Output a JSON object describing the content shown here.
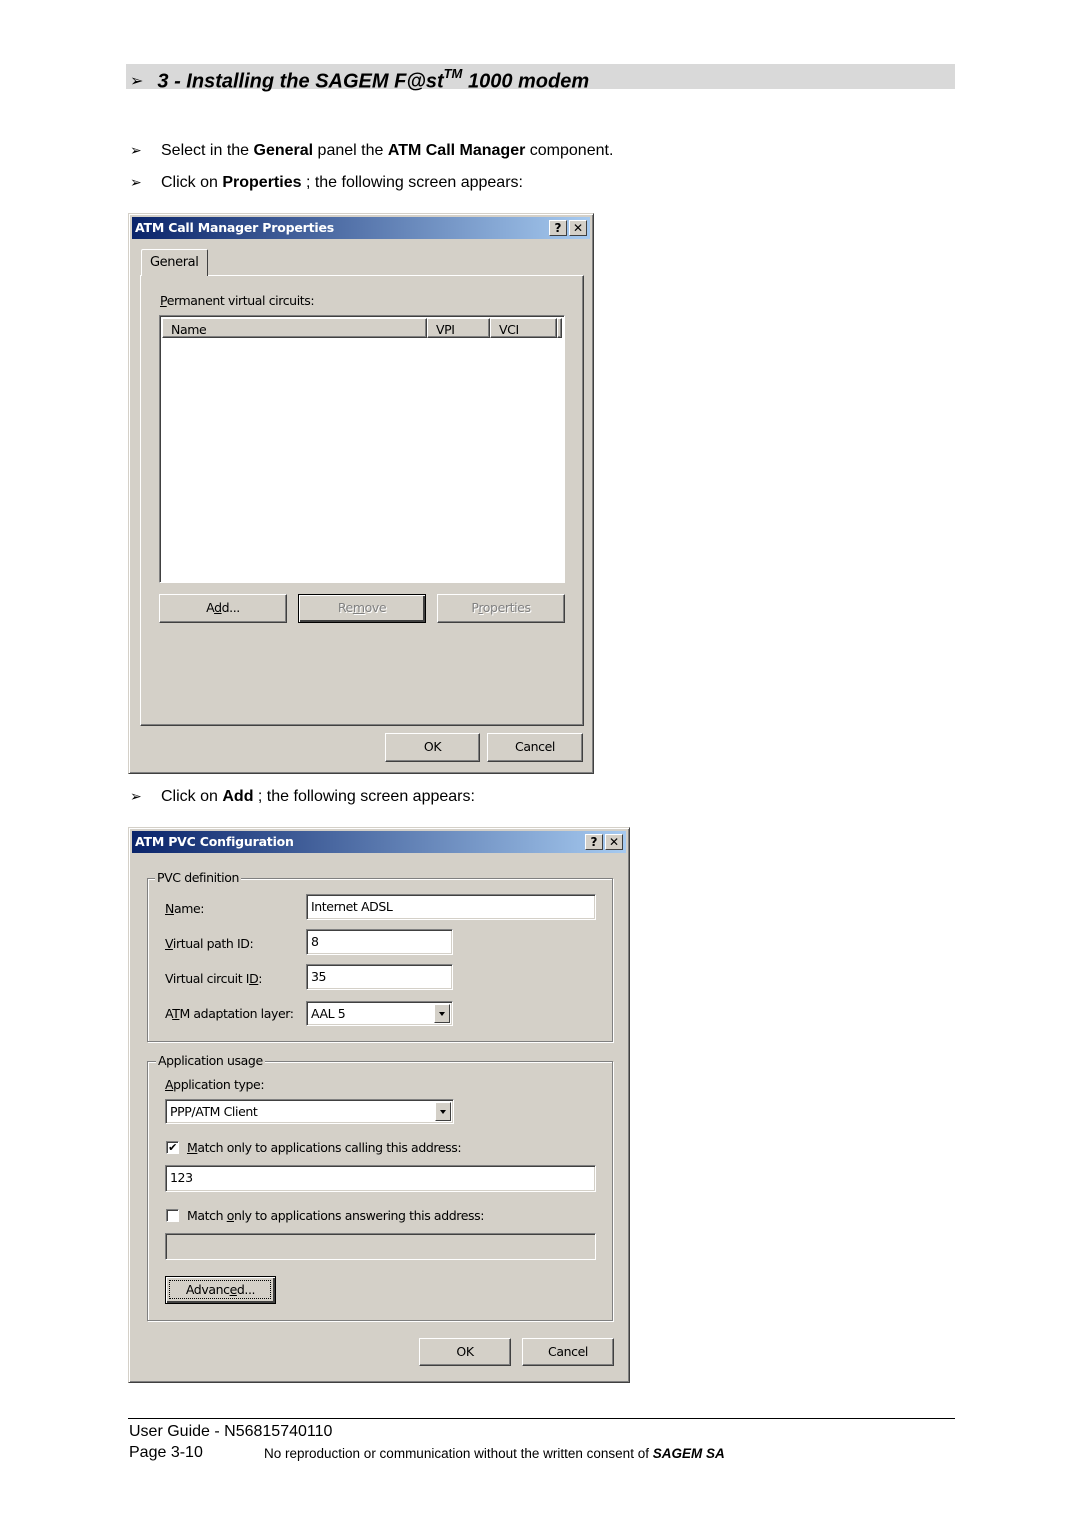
{
  "document": {
    "heading": {
      "bullet": "➢",
      "text_pre": "3 - Installing the SAGEM F@st",
      "superscript": "TM",
      "text_post": " 1000 modem"
    },
    "steps": [
      {
        "bullet": "➢",
        "parts": [
          "Select in the ",
          "General",
          " panel the ",
          "ATM Call Manager",
          " component."
        ]
      },
      {
        "bullet": "➢",
        "parts": [
          "Click on ",
          "Properties",
          " ; the following screen appears:"
        ]
      },
      {
        "bullet": "➢",
        "parts": [
          "Click on ",
          "Add",
          " ; the following screen appears:"
        ]
      }
    ],
    "footer": {
      "guide": "User Guide - N56815740110",
      "page": "Page 3-10",
      "notice": "No reproduction or communication without the written consent of ",
      "company": "SAGEM SA"
    }
  },
  "dialog_call_manager": {
    "title": "ATM Call Manager Properties",
    "help_button": "?",
    "close_button": "✕",
    "tab": "General",
    "pvc_label": {
      "accel": "P",
      "rest": "ermanent virtual circuits:"
    },
    "columns": [
      "Name",
      "VPI",
      "VCI"
    ],
    "rows": [],
    "buttons": {
      "add": {
        "pre": "A",
        "accel": "d",
        "post": "d..."
      },
      "remove": {
        "pre": "Re",
        "accel": "m",
        "post": "ove"
      },
      "properties": {
        "pre": "P",
        "accel": "r",
        "post": "operties"
      },
      "ok": "OK",
      "cancel": "Cancel"
    }
  },
  "dialog_pvc_config": {
    "title": "ATM PVC Configuration",
    "help_button": "?",
    "close_button": "✕",
    "pvc_definition": {
      "legend": "PVC definition",
      "name": {
        "label_accel": "N",
        "label_rest": "ame:",
        "value": "Internet ADSL"
      },
      "vpi": {
        "label_accel": "V",
        "label_rest": "irtual path ID:",
        "value": "8"
      },
      "vci": {
        "label_pre": "Virtual circuit I",
        "label_accel": "D",
        "label_post": ":",
        "value": "35"
      },
      "aal": {
        "label_pre": "A",
        "label_accel": "T",
        "label_post": "M adaptation layer:",
        "value": "AAL 5"
      }
    },
    "application_usage": {
      "legend": "Application usage",
      "type_label": {
        "accel": "A",
        "rest": "pplication type:"
      },
      "type_value": "PPP/ATM Client",
      "match_calling": {
        "checked": true,
        "check_glyph": "✔",
        "accel": "M",
        "rest": "atch only to applications calling this address:",
        "value": "123"
      },
      "match_answering": {
        "checked": false,
        "pre": "Match ",
        "accel": "o",
        "rest": "nly to applications answering this address:",
        "value": ""
      },
      "advanced": {
        "pre": "Advanc",
        "accel": "e",
        "post": "d..."
      }
    },
    "buttons": {
      "ok": "OK",
      "cancel": "Cancel"
    }
  }
}
